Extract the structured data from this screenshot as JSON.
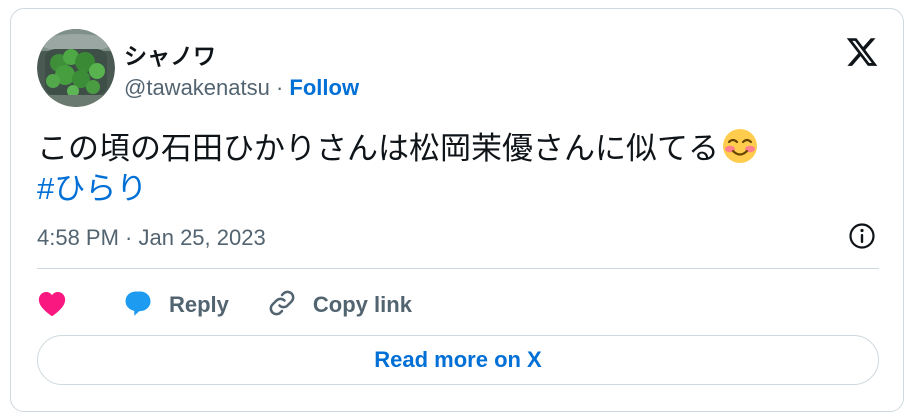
{
  "author": {
    "display_name": "シャノワ",
    "handle": "@tawakenatsu",
    "separator": " · ",
    "follow_label": "Follow",
    "avatar_icon": "avatar-plant-photo"
  },
  "brand": {
    "logo_icon": "x-logo-icon"
  },
  "tweet": {
    "text": "この頃の石田ひかりさんは松岡茉優さんに似てる",
    "emoji": "smiling-face-with-smiling-eyes-emoji",
    "hashtag": "#ひらり",
    "timestamp": "4:58 PM · Jan 25, 2023"
  },
  "actions": {
    "like_icon": "heart-icon",
    "reply_label": "Reply",
    "reply_icon": "speech-bubble-icon",
    "copy_label": "Copy link",
    "copy_icon": "link-icon",
    "info_icon": "info-icon"
  },
  "read_more_label": "Read more on X",
  "colors": {
    "text": "#0f1419",
    "secondary": "#536471",
    "link": "#006fd6",
    "heart": "#f91880",
    "reply": "#1d9bf0",
    "border": "#cfd9de"
  }
}
